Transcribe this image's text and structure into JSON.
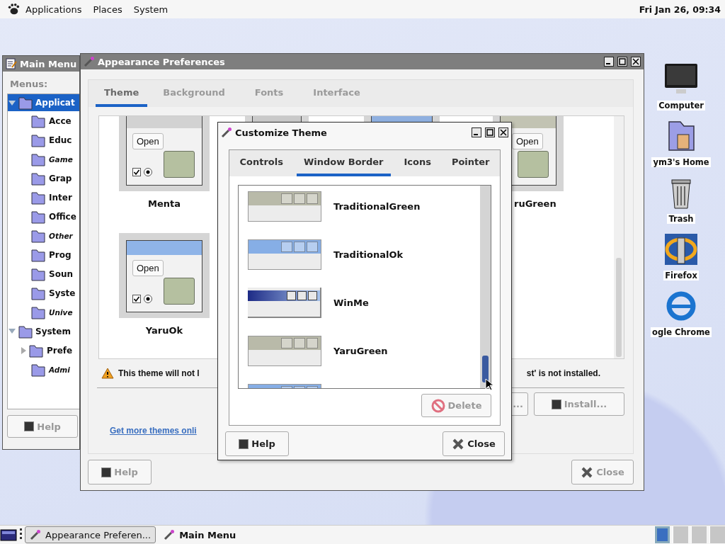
{
  "top_panel": {
    "menus": [
      "Applications",
      "Places",
      "System"
    ],
    "clock": "Fri Jan 26, 09:34"
  },
  "desktop_icons": [
    {
      "kind": "computer",
      "label": "Computer"
    },
    {
      "kind": "home",
      "label": "ym3's Home"
    },
    {
      "kind": "trash",
      "label": "Trash"
    },
    {
      "kind": "firefox",
      "label": "Firefox"
    },
    {
      "kind": "browser",
      "label": "ogle Chrome"
    }
  ],
  "main_menu": {
    "title": "Main Menu",
    "menus_label": "Menus:",
    "tree": [
      {
        "label": "Applicat",
        "expanded": true,
        "selected": true,
        "children": [
          {
            "label": "Acce",
            "italic": false,
            "selected": false
          },
          {
            "label": "Educ",
            "italic": false,
            "selected": false
          },
          {
            "label": "Game",
            "italic": true,
            "selected": false
          },
          {
            "label": "Grap",
            "italic": false,
            "selected": false
          },
          {
            "label": "Inter",
            "italic": false,
            "selected": false
          },
          {
            "label": "Office",
            "italic": false,
            "selected": false
          },
          {
            "label": "Other",
            "italic": true,
            "selected": false
          },
          {
            "label": "Prog",
            "italic": false,
            "selected": false
          },
          {
            "label": "Soun",
            "italic": false,
            "selected": false
          },
          {
            "label": "Syste",
            "italic": false,
            "selected": false
          },
          {
            "label": "Unive",
            "italic": true,
            "selected": false
          }
        ]
      },
      {
        "label": "System",
        "expanded": true,
        "selected": false,
        "children": [
          {
            "label": "Prefe",
            "italic": false,
            "selected": false,
            "expanded": false
          },
          {
            "label": "Admi",
            "italic": true,
            "selected": false
          }
        ]
      }
    ],
    "help_button": {
      "label": "Help",
      "disabled": true
    }
  },
  "appearance": {
    "title": "Appearance Preferences",
    "tabs": [
      {
        "label": "Theme",
        "selected": true
      },
      {
        "label": "Background",
        "selected": false
      },
      {
        "label": "Fonts",
        "selected": false
      },
      {
        "label": "Interface",
        "selected": false
      }
    ],
    "theme_rows": [
      [
        {
          "name": "Menta",
          "color": "#d2d2d2",
          "preview_button": "Open",
          "checkbox_checked": true,
          "radio_selected": true
        },
        {
          "color": "#c9c9c9"
        },
        {
          "color": "#8fb0e0"
        },
        {
          "name": "ruGreen",
          "color": "#c2c3b3",
          "preview_button": "Open"
        }
      ],
      [
        {
          "name": "YaruOk",
          "color": "#8fb4e8",
          "preview_button": "Open",
          "checkbox_checked": true,
          "radio_selected": true
        }
      ]
    ],
    "warning_start": "This theme will not l",
    "warning_end": "st' is not installed.",
    "action_buttons": [
      {
        "label": "...",
        "disabled": true
      },
      {
        "label": "Install...",
        "disabled": true
      }
    ],
    "link": "Get more themes onli",
    "help_button": {
      "label": "Help",
      "disabled": true
    },
    "close_button": {
      "label": "Close",
      "disabled": true
    }
  },
  "customize": {
    "title": "Customize Theme",
    "tabs": [
      {
        "label": "Controls",
        "selected": false
      },
      {
        "label": "Window Border",
        "selected": true
      },
      {
        "label": "Icons",
        "selected": false
      },
      {
        "label": "Pointer",
        "selected": false
      }
    ],
    "borders": [
      {
        "name": "TraditionalGreen",
        "kind": "flat",
        "color": "#b9baa9"
      },
      {
        "name": "TraditionalOk",
        "kind": "flat",
        "color": "#86aee6"
      },
      {
        "name": "WinMe",
        "kind": "gradient",
        "color": "#1d2b86"
      },
      {
        "name": "YaruGreen",
        "kind": "flat",
        "color": "#b9baa9"
      },
      {
        "kind": "flat",
        "color": "#86aee6"
      }
    ],
    "delete_button": {
      "label": "Delete",
      "disabled": true
    },
    "help_button": {
      "label": "Help",
      "disabled": false
    },
    "close_button": {
      "label": "Close",
      "disabled": false
    }
  },
  "taskbar": {
    "tasks": [
      {
        "label": "Appearance Preferen...",
        "selected": true
      },
      {
        "label": "Main Menu",
        "selected": false
      }
    ],
    "workspaces": [
      {
        "selected": true
      },
      {
        "selected": false
      },
      {
        "selected": false
      },
      {
        "selected": false
      }
    ]
  }
}
